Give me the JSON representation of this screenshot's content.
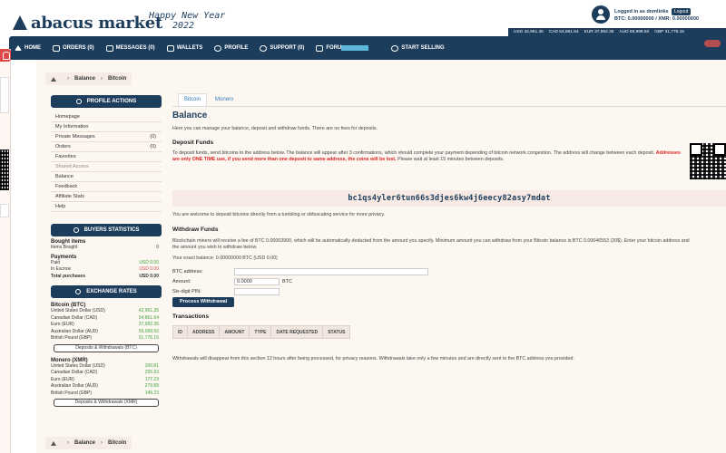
{
  "header": {
    "logo_text": "abacus market",
    "greeting_line1": "Happy New Year",
    "greeting_line2": "2022",
    "user_logged": "Logged in as dnmlinks",
    "logout_label": "Logout",
    "user_balance": "BTC: 0.00000000 / XMR: 0.00000000"
  },
  "rates_strip": [
    "USD 42,961.35",
    "CAD 54,861.64",
    "EUR 37,992.35",
    "AUD 59,999.50",
    "GBP 31,776.15"
  ],
  "nav": {
    "home": "HOME",
    "orders": "ORDERS (0)",
    "messages": "MESSAGES (0)",
    "wallets": "WALLETS",
    "profile": "PROFILE",
    "support": "SUPPORT (0)",
    "forum": "FORU",
    "start_selling": "START SELLING"
  },
  "breadcrumb": {
    "item1": "Balance",
    "item2": "Bitcoin"
  },
  "sidebar": {
    "profile_actions_title": "PROFILE ACTIONS",
    "profile_items": [
      {
        "label": "Homepage",
        "count": ""
      },
      {
        "label": "My Information",
        "count": ""
      },
      {
        "label": "Private Messages",
        "count": "(0)"
      },
      {
        "label": "Orders",
        "count": "(0)"
      },
      {
        "label": "Favorites",
        "count": ""
      },
      {
        "label": "Shared Access",
        "count": ""
      },
      {
        "label": "Balance",
        "count": ""
      },
      {
        "label": "Feedback",
        "count": ""
      },
      {
        "label": "Affiliate Stats",
        "count": ""
      },
      {
        "label": "Help",
        "count": ""
      }
    ],
    "buyers_stats_title": "BUYERS STATISTICS",
    "bought_items_title": "Bought items",
    "items_bought_label": "Items Bought",
    "items_bought_value": "0",
    "payments_title": "Payments",
    "paid_label": "Paid",
    "paid_value": "USD 0.00",
    "escrow_label": "In Escrow",
    "escrow_value": "USD 0.00",
    "total_label": "Total purchases",
    "total_value": "USD 0.00",
    "exchange_title": "EXCHANGE RATES",
    "btc_title": "Bitcoin (BTC)",
    "btc_rates": [
      {
        "label": "United States Dollar (USD)",
        "value": "42,961.35"
      },
      {
        "label": "Canadian Dollar (CAD)",
        "value": "54,861.64"
      },
      {
        "label": "Euro (EUR)",
        "value": "37,992.35"
      },
      {
        "label": "Australian Dollar (AUD)",
        "value": "59,999.50"
      },
      {
        "label": "British Pound (GBP)",
        "value": "31,776.15"
      }
    ],
    "btc_button": "Deposits & Withdrawals (BTC)",
    "xmr_title": "Monero (XMR)",
    "xmr_rates": [
      {
        "label": "United States Dollar (USD)",
        "value": "200.81"
      },
      {
        "label": "Canadian Dollar (CAD)",
        "value": "255.93"
      },
      {
        "label": "Euro (EUR)",
        "value": "177.23"
      },
      {
        "label": "Australian Dollar (AUD)",
        "value": "279.89"
      },
      {
        "label": "British Pound (GBP)",
        "value": "149.23"
      }
    ],
    "xmr_button": "Deposits & Withdrawals (XMR)"
  },
  "tabs": {
    "bitcoin": "Bitcoin",
    "monero": "Monero"
  },
  "content": {
    "title": "Balance",
    "intro": "Here you can manage your balance, deposit and withdraw funds. There are no fees for deposits.",
    "deposit_title": "Deposit Funds",
    "deposit_text_1": "To deposit funds, send bitcoins to the address below. The balance will appear after 3 confirmations, which should complete your payment depending of bitcoin network congestion. The address will change between each",
    "deposit_text_2a": "deposit.",
    "deposit_warning": "Addresses are only ONE TIME use, if you send more than one deposit to same address, the coins will be lost.",
    "deposit_text_2b": "Please wait at least 15 minutes between deposits.",
    "address": "bc1qs4yler6tun66s3djes6kw4j6eecy82asy7mdat",
    "tumbler_note": "You are welcome to deposit bitcoins directly from a tumbling or obfuscating service for more privacy.",
    "withdraw_title": "Withdraw Funds",
    "withdraw_text_1": "Blockchain miners will receive a fee of BTC 0.00003900, which will be automatically deducted from the amount you specify. Minimum amount you can withdraw from your Bitcoin balance is BTC 0.00046553 (20$). Enter your bitcoin address and",
    "withdraw_text_2": "the amount you wish to withdraw below.",
    "exact_balance": "Your exact balance: 0.00000000 BTC (USD 0.00)",
    "btc_address_label": "BTC address:",
    "amount_label": "Amount:",
    "amount_value": "0.0000",
    "amount_unit": "BTC",
    "pin_label": "Six-digit PIN:",
    "process_button": "Process Withdrawal",
    "transactions_title": "Transactions",
    "table_headers": [
      "ID",
      "ADDRESS",
      "AMOUNT",
      "TYPE",
      "DATE REQUESTED",
      "STATUS"
    ],
    "footer_note": "Withdrawals will disappear from this section 12 hours after being processed, for privacy reasons. Withdrawals take only a few minutes and are directly sent to the BTC address you provided."
  },
  "colors": {
    "brand": "#1d3d5c",
    "green": "#3aa33a",
    "red": "#d22222"
  }
}
